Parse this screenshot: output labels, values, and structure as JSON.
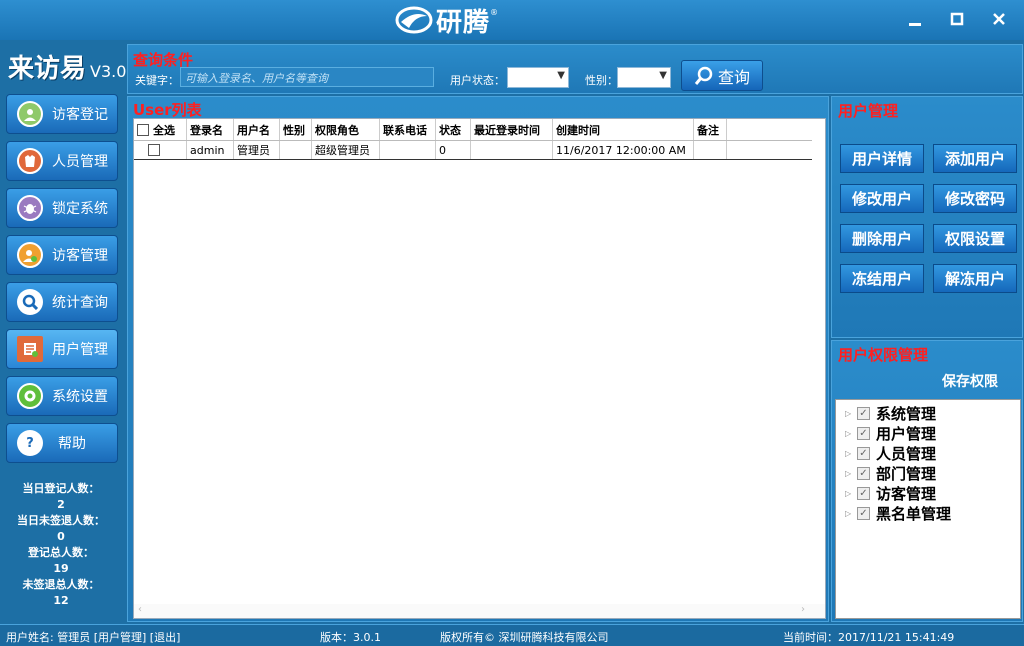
{
  "titlebar": {
    "brand": "研腾",
    "reg": "®"
  },
  "app": {
    "name": "来访易",
    "version": "V3.0"
  },
  "query": {
    "title": "查询条件",
    "keyword_label": "关键字：",
    "keyword_placeholder": "可输入登录名、用户名等查询",
    "status_label": "用户状态：",
    "status_value": "",
    "gender_label": "性别：",
    "gender_value": "",
    "search_label": "查询"
  },
  "sidebar": {
    "items": [
      {
        "label": "访客登记",
        "icon": "visitor-register-icon"
      },
      {
        "label": "人员管理",
        "icon": "staff-icon"
      },
      {
        "label": "锁定系统",
        "icon": "lock-bug-icon"
      },
      {
        "label": "访客管理",
        "icon": "visitor-manage-icon"
      },
      {
        "label": "统计查询",
        "icon": "search-icon"
      },
      {
        "label": "用户管理",
        "icon": "user-manage-icon"
      },
      {
        "label": "系统设置",
        "icon": "gear-icon"
      },
      {
        "label": "帮助",
        "icon": "help-icon"
      }
    ],
    "active_index": 5
  },
  "stats": {
    "today_label": "当日登记人数：",
    "today_value": "2",
    "today_not_signed_label": "当日未签退人数：",
    "today_not_signed_value": "0",
    "total_label": "登记总人数：",
    "total_value": "19",
    "total_not_signed_label": "未签退总人数：",
    "total_not_signed_value": "12"
  },
  "user_list": {
    "title": "User列表",
    "columns": [
      "全选",
      "登录名",
      "用户名",
      "性别",
      "权限角色",
      "联系电话",
      "状态",
      "最近登录时间",
      "创建时间",
      "备注"
    ],
    "rows": [
      [
        "",
        "admin",
        "管理员",
        "",
        "超级管理员",
        "",
        "0",
        "",
        "11/6/2017 12:00:00 AM",
        ""
      ]
    ]
  },
  "user_mgmt": {
    "title": "用户管理",
    "buttons": [
      "用户详情",
      "添加用户",
      "修改用户",
      "修改密码",
      "删除用户",
      "权限设置",
      "冻结用户",
      "解冻用户"
    ]
  },
  "perm": {
    "title": "用户权限管理",
    "save_label": "保存权限",
    "items": [
      "系统管理",
      "用户管理",
      "人员管理",
      "部门管理",
      "访客管理",
      "黑名单管理"
    ]
  },
  "status": {
    "user": "用户姓名: 管理员  [用户管理]  [退出]",
    "version": "版本：3.0.1",
    "copyright": "版权所有© 深圳研腾科技有限公司",
    "time": "当前时间：2017/11/21 15:41:49"
  },
  "colors": {
    "accent": "#1f78b6",
    "title_red": "#ff2020"
  }
}
